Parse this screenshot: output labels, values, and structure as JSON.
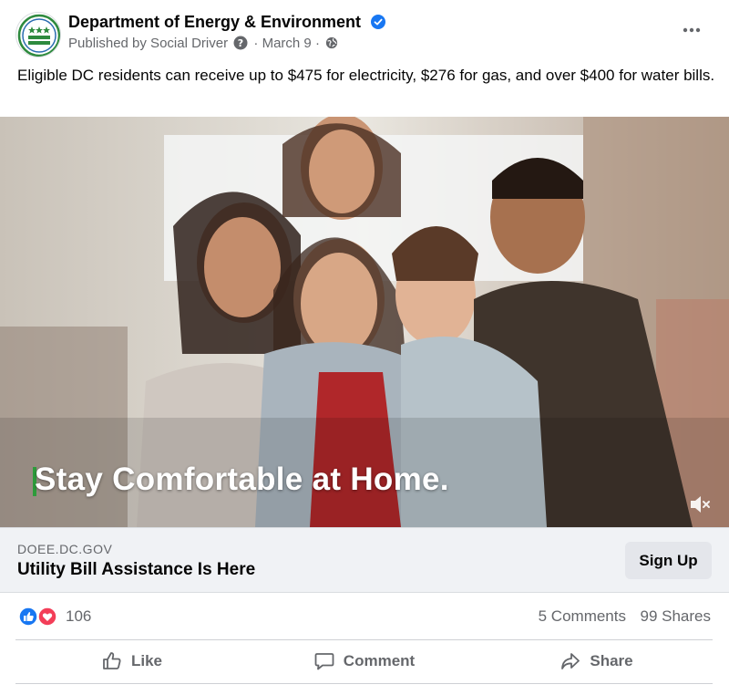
{
  "post": {
    "page_name": "Department of Energy & Environment",
    "published_by": "Published by Social Driver",
    "date": "March 9",
    "separator": "·",
    "text": "Eligible DC residents can receive up to $475 for electricity, $276 for gas, and over $400 for water bills."
  },
  "icons": {
    "verified": "verified-badge-icon",
    "help": "help-question-icon",
    "globe": "globe-icon",
    "more": "more-options-icon",
    "mute": "volume-muted-icon",
    "like_reaction": "like-reaction-icon",
    "love_reaction": "love-reaction-icon",
    "like": "thumbs-up-icon",
    "comment": "comment-bubble-icon",
    "share": "share-arrow-icon"
  },
  "media": {
    "caption": "Stay Comfortable at Home."
  },
  "link_card": {
    "domain": "DOEE.DC.GOV",
    "title": "Utility Bill Assistance Is Here",
    "cta_label": "Sign Up"
  },
  "engagement": {
    "reaction_count": "106",
    "comments": "5 Comments",
    "shares": "99 Shares"
  },
  "actions": {
    "like": "Like",
    "comment": "Comment",
    "share": "Share"
  },
  "colors": {
    "verified_blue": "#1877f2",
    "caption_accent": "#2e9b3b",
    "love_red": "#f33e58",
    "secondary_text": "#65676b"
  }
}
